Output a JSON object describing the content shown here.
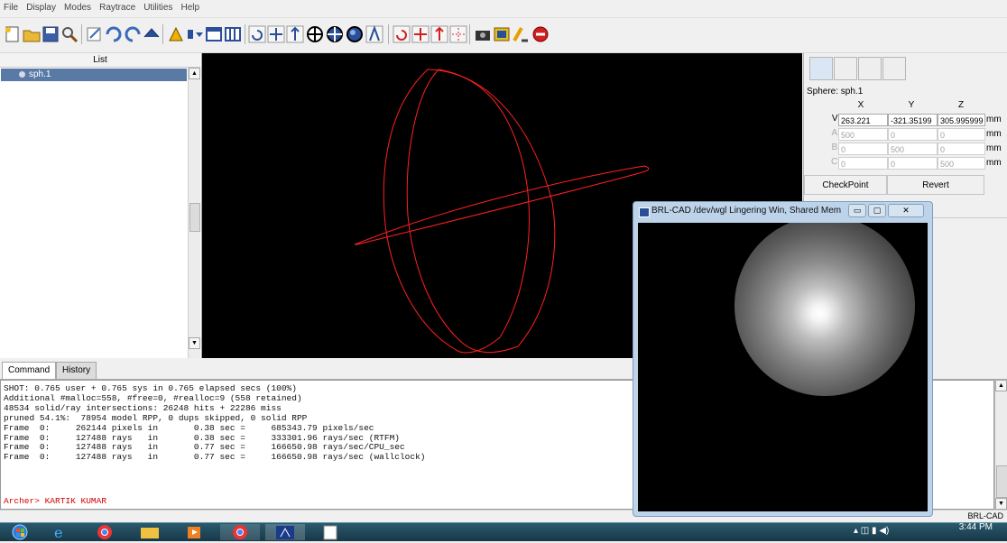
{
  "menu": [
    "File",
    "Display",
    "Modes",
    "Raytrace",
    "Utilities",
    "Help"
  ],
  "list": {
    "header": "List",
    "items": [
      "sph.1"
    ]
  },
  "edit_panel": {
    "object_label": "Sphere: sph.1",
    "columns": [
      "X",
      "Y",
      "Z"
    ],
    "rows": [
      {
        "label": "V:",
        "values": [
          "263.221",
          "-321.35199",
          "305.995999"
        ],
        "unit": "mm",
        "enabled": true
      },
      {
        "label": "A:",
        "values": [
          "500",
          "0",
          "0"
        ],
        "unit": "mm",
        "enabled": false
      },
      {
        "label": "B:",
        "values": [
          "0",
          "500",
          "0"
        ],
        "unit": "mm",
        "enabled": false
      },
      {
        "label": "C:",
        "values": [
          "0",
          "0",
          "500"
        ],
        "unit": "mm",
        "enabled": false
      }
    ],
    "checkpoint_label": "CheckPoint",
    "revert_label": "Revert"
  },
  "command_tabs": [
    "Command",
    "History"
  ],
  "console_lines": [
    "SHOT: 0.765 user + 0.765 sys in 0.765 elapsed secs (100%)",
    "Additional #malloc=558, #free=0, #realloc=9 (558 retained)",
    "48534 solid/ray intersections: 26248 hits + 22286 miss",
    "pruned 54.1%:  78954 model RPP, 0 dups skipped, 0 solid RPP",
    "Frame  0:     262144 pixels in       0.38 sec =     685343.79 pixels/sec",
    "Frame  0:     127488 rays   in       0.38 sec =     333301.96 rays/sec (RTFM)",
    "Frame  0:     127488 rays   in       0.77 sec =     166650.98 rays/sec/CPU_sec",
    "Frame  0:     127488 rays   in       0.77 sec =     166650.98 rays/sec (wallclock)"
  ],
  "prompt_text": "Archer> KARTIK KUMAR",
  "status_label": "BRL-CAD",
  "raytrace_window": {
    "title": "BRL-CAD /dev/wgl Lingering Win, Shared Mem"
  },
  "clock": "3:44 PM",
  "colors": {
    "wireframe": "#ff2020",
    "selection": "#5a7aa6",
    "prompt": "#d40000"
  }
}
